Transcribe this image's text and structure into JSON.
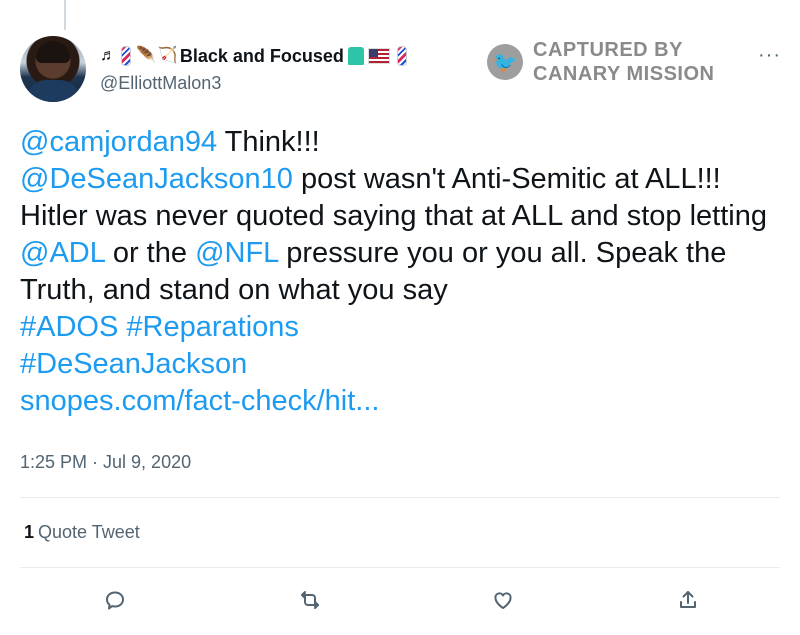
{
  "author": {
    "display_name": "Black and Focused",
    "handle": "@ElliottMalon3",
    "emojis": {
      "music_note": "♬",
      "feather": "🪶",
      "bow": "🏹"
    }
  },
  "watermark": {
    "line1": "CAPTURED BY",
    "line2": "CANARY MISSION",
    "badge_glyph": "🐦"
  },
  "more_menu": "···",
  "tweet": {
    "mention1": "@camjordan94",
    "text1": " Think!!!",
    "mention2": "@DeSeanJackson10",
    "text2": " post wasn't Anti-Semitic at ALL!!! Hitler was never quoted saying that at ALL and stop letting ",
    "mention3": "@ADL",
    "text3": " or the ",
    "mention4": "@NFL",
    "text4": " pressure you or you all. Speak the Truth, and stand on what you say",
    "hashtag1": "#ADOS",
    "hashtag2": "#Reparations",
    "hashtag3": "#DeSeanJackson",
    "url": "snopes.com/fact-check/hit..."
  },
  "timestamp": "1:25 PM · Jul 9, 2020",
  "stats": {
    "quote_count": "1",
    "quote_label": "Quote Tweet"
  },
  "colors": {
    "link": "#1d9bf0",
    "secondary_text": "#536471",
    "primary_text": "#0f1419",
    "watermark": "#8a8a8a"
  },
  "icons": [
    "reply-icon",
    "retweet-icon",
    "like-icon",
    "share-icon"
  ]
}
